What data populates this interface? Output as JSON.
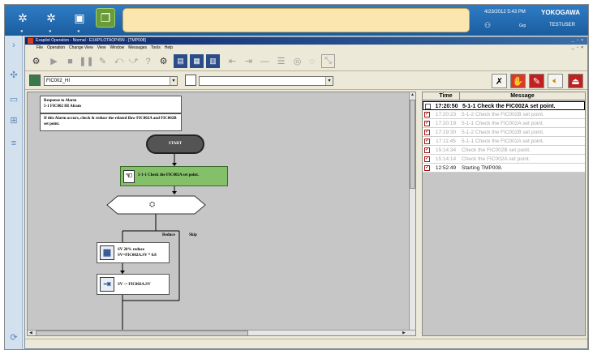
{
  "system_bar": {
    "datetime": "4/23/2012 5:43 PM",
    "brand": "YOKOGAWA",
    "small_label": "Grp",
    "user": "TESTUSER",
    "icons": [
      "sun-icon",
      "sun-icon",
      "window-icon",
      "windows-icon"
    ]
  },
  "window": {
    "title": "Exapilot Operation - Normal : EXAPILOTAOP45N - [TMP008]",
    "menu": [
      "File",
      "Operation",
      "Change View",
      "View",
      "Window",
      "Messages",
      "Tools",
      "Help"
    ]
  },
  "selector": {
    "procedure": "FIC002_HI",
    "secondary": ""
  },
  "flowchart": {
    "header_title": "Response to Alarm",
    "header_subtitle": "5-1 FIC002 HI Alram",
    "description": "If this Alarm occurs, check & reduce the related flow FIC002A and FIC002B set point.",
    "start_label": "START",
    "step_label": "5-1-1 Check the FIC002A set point.",
    "branch_reduce": "Reduce",
    "branch_skip": "Skip",
    "op1_line1": "SV 20% reduce",
    "op1_line2": "SV=FIC002A.SV * 0.8",
    "op2_line1": "SV -> FIC002A.SV"
  },
  "messages": {
    "col_time": "Time",
    "col_message": "Message",
    "rows": [
      {
        "time": "17:20:50",
        "message": "5-1-1 Check the FIC002A set point.",
        "checked": false,
        "state": "active"
      },
      {
        "time": "17:20:23",
        "message": "5-1-2 Check the FIC002B set point.",
        "checked": true,
        "state": "past"
      },
      {
        "time": "17:20:19",
        "message": "5-1-1 Check the FIC002A set point.",
        "checked": true,
        "state": "past"
      },
      {
        "time": "17:19:30",
        "message": "5-1-2 Check the FIC002B set point.",
        "checked": true,
        "state": "past"
      },
      {
        "time": "17:11:45",
        "message": "5-1-1 Check the FIC002A set point.",
        "checked": true,
        "state": "past"
      },
      {
        "time": "15:14:34",
        "message": "Check the FIC002B set point.",
        "checked": true,
        "state": "past"
      },
      {
        "time": "15:14:14",
        "message": "Check the FIC002A set point.",
        "checked": true,
        "state": "past"
      },
      {
        "time": "12:52:49",
        "message": "Starting TMP008.",
        "checked": true,
        "state": "recent"
      }
    ]
  }
}
